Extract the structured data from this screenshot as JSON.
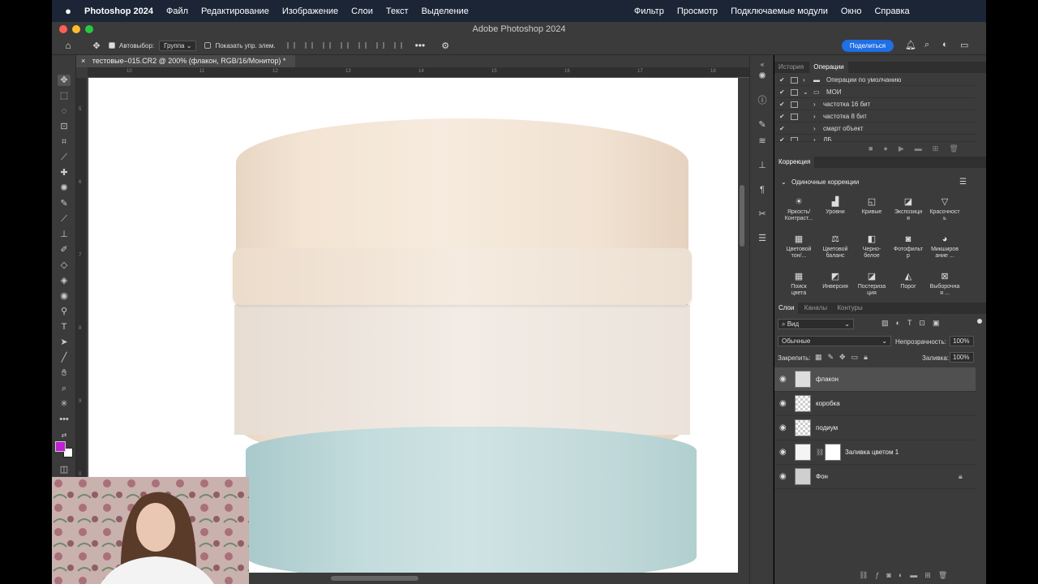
{
  "menubar": {
    "app_name": "Photoshop 2024",
    "items_left": [
      "Файл",
      "Редактирование",
      "Изображение",
      "Слои",
      "Текст",
      "Выделение"
    ],
    "items_right": [
      "Фильтр",
      "Просмотр",
      "Подключаемые модули",
      "Окно",
      "Справка"
    ]
  },
  "window": {
    "title": "Adobe Photoshop 2024"
  },
  "options_bar": {
    "auto_select_label": "Автовыбор:",
    "auto_select_value": "Группа",
    "show_transform_label": "Показать упр. элем.",
    "share_label": "Поделиться"
  },
  "document": {
    "tab_title": "тестовые–015.CR2 @ 200% (флакон, RGB/16/Монитор) *",
    "ruler_top": [
      "10",
      "11",
      "12",
      "13",
      "14",
      "15",
      "16",
      "17",
      "18"
    ],
    "ruler_left": [
      "5",
      "6",
      "7",
      "8",
      "9",
      "0"
    ]
  },
  "actions_panel": {
    "tabs": [
      "История",
      "Операции"
    ],
    "active_tab": "Операции",
    "rows": [
      {
        "label": "Операции по умолчанию",
        "type": "folder"
      },
      {
        "label": "МОИ",
        "type": "folder"
      },
      {
        "label": "частотка 16 бит",
        "type": "action"
      },
      {
        "label": "частотка 8 бит",
        "type": "action"
      },
      {
        "label": "смарт объект",
        "type": "action"
      },
      {
        "label": "ДБ",
        "type": "action"
      }
    ]
  },
  "corrections_panel": {
    "title": "Коррекция",
    "section": "Одиночные коррекции",
    "items": [
      {
        "label": "Яркость/\nКонтраст...",
        "icon": "sun-icon"
      },
      {
        "label": "Уровни",
        "icon": "levels-icon"
      },
      {
        "label": "Кривые",
        "icon": "curves-icon"
      },
      {
        "label": "Экспозици\nя",
        "icon": "exposure-icon"
      },
      {
        "label": "Красочност\nь",
        "icon": "vibrance-icon"
      },
      {
        "label": "Цветовой\nтон/...",
        "icon": "hue-icon"
      },
      {
        "label": "Цветовой\nбаланс",
        "icon": "balance-icon"
      },
      {
        "label": "Черно-\nбелое",
        "icon": "bw-icon"
      },
      {
        "label": "Фотофильт\nр",
        "icon": "camera-icon"
      },
      {
        "label": "Микширов\nание ...",
        "icon": "mixer-icon"
      },
      {
        "label": "Поиск\nцвета",
        "icon": "lookup-icon"
      },
      {
        "label": "Инверсия",
        "icon": "invert-icon"
      },
      {
        "label": "Постериза\nция",
        "icon": "posterize-icon"
      },
      {
        "label": "Порог",
        "icon": "threshold-icon"
      },
      {
        "label": "Выборочна\nя ...",
        "icon": "selective-icon"
      }
    ]
  },
  "layers_panel": {
    "tabs": [
      "Слои",
      "Каналы",
      "Контуры"
    ],
    "active_tab": "Слои",
    "filter_label": "Вид",
    "blend_mode": "Обычные",
    "opacity_label": "Непрозрачность:",
    "opacity_value": "100%",
    "lock_label": "Закрепить:",
    "fill_label": "Заливка:",
    "fill_value": "100%",
    "layers": [
      {
        "name": "флакон",
        "selected": true
      },
      {
        "name": "коробка",
        "selected": false
      },
      {
        "name": "подиум",
        "selected": false
      },
      {
        "name": "Заливка цветом 1",
        "selected": false
      },
      {
        "name": "Фон",
        "selected": false
      }
    ]
  },
  "colors": {
    "menubar_bg": "#1b2536",
    "panel_bg": "#3b3b3b",
    "share_button": "#1f6fe5",
    "foreground_swatch": "#c21ed6"
  }
}
